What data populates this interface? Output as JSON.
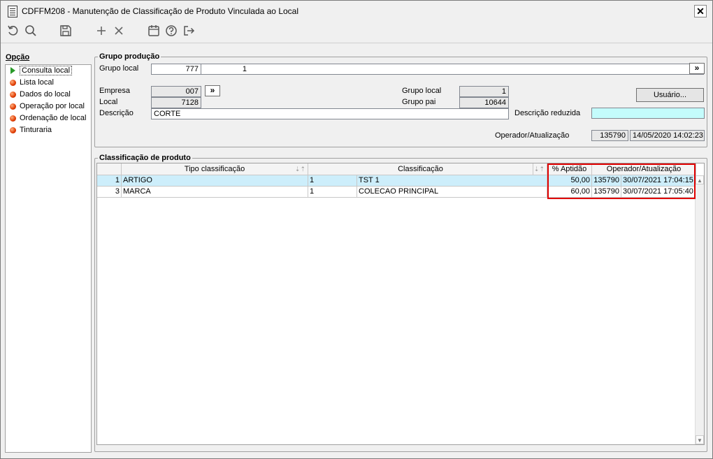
{
  "window": {
    "title": "CDFFM208 - Manutenção de Classificação de Produto Vinculada ao Local",
    "close_label": "✕"
  },
  "toolbar": {
    "icons": [
      "undo-icon",
      "search-icon",
      "save-icon",
      "add-icon",
      "delete-icon",
      "calendar-icon",
      "help-icon",
      "exit-icon"
    ]
  },
  "sidebar": {
    "title": "Opção",
    "items": [
      {
        "label": "Consulta local"
      },
      {
        "label": "Lista local"
      },
      {
        "label": "Dados do local"
      },
      {
        "label": "Operação por local"
      },
      {
        "label": "Ordenação de local"
      },
      {
        "label": "Tinturaria"
      }
    ]
  },
  "grupo": {
    "title": "Grupo produção",
    "grupo_local_label": "Grupo local",
    "grupo_local_value1": "777",
    "grupo_local_value2": "1",
    "nav_button": "»",
    "empresa_label": "Empresa",
    "empresa_value": "007",
    "local_label": "Local",
    "local_value": "7128",
    "descricao_label": "Descrição",
    "descricao_value": "CORTE",
    "grupo_local2_label": "Grupo local",
    "grupo_local2_value": "1",
    "grupo_pai_label": "Grupo pai",
    "grupo_pai_value": "10644",
    "usuario_button": "Usuário...",
    "descricao_reduzida_label": "Descrição reduzida",
    "descricao_reduzida_value": "",
    "operador_label": "Operador/Atualização",
    "operador_value": "135790",
    "atualizacao_value": "14/05/2020 14:02:23"
  },
  "classificacao": {
    "title": "Classificação de produto",
    "columns": [
      "Tipo classificação",
      "Classificação",
      "% Aptidão",
      "Operador/Atualização"
    ],
    "rows": [
      {
        "tipo_id": "1",
        "tipo": "ARTIGO",
        "class_id": "1",
        "classificacao": "TST 1",
        "aptidao": "50,00",
        "operador": "135790",
        "data": "30/07/2021 17:04:15"
      },
      {
        "tipo_id": "3",
        "tipo": "MARCA",
        "class_id": "1",
        "classificacao": "COLECAO PRINCIPAL",
        "aptidao": "60,00",
        "operador": "135790",
        "data": "30/07/2021 17:05:40"
      }
    ]
  }
}
